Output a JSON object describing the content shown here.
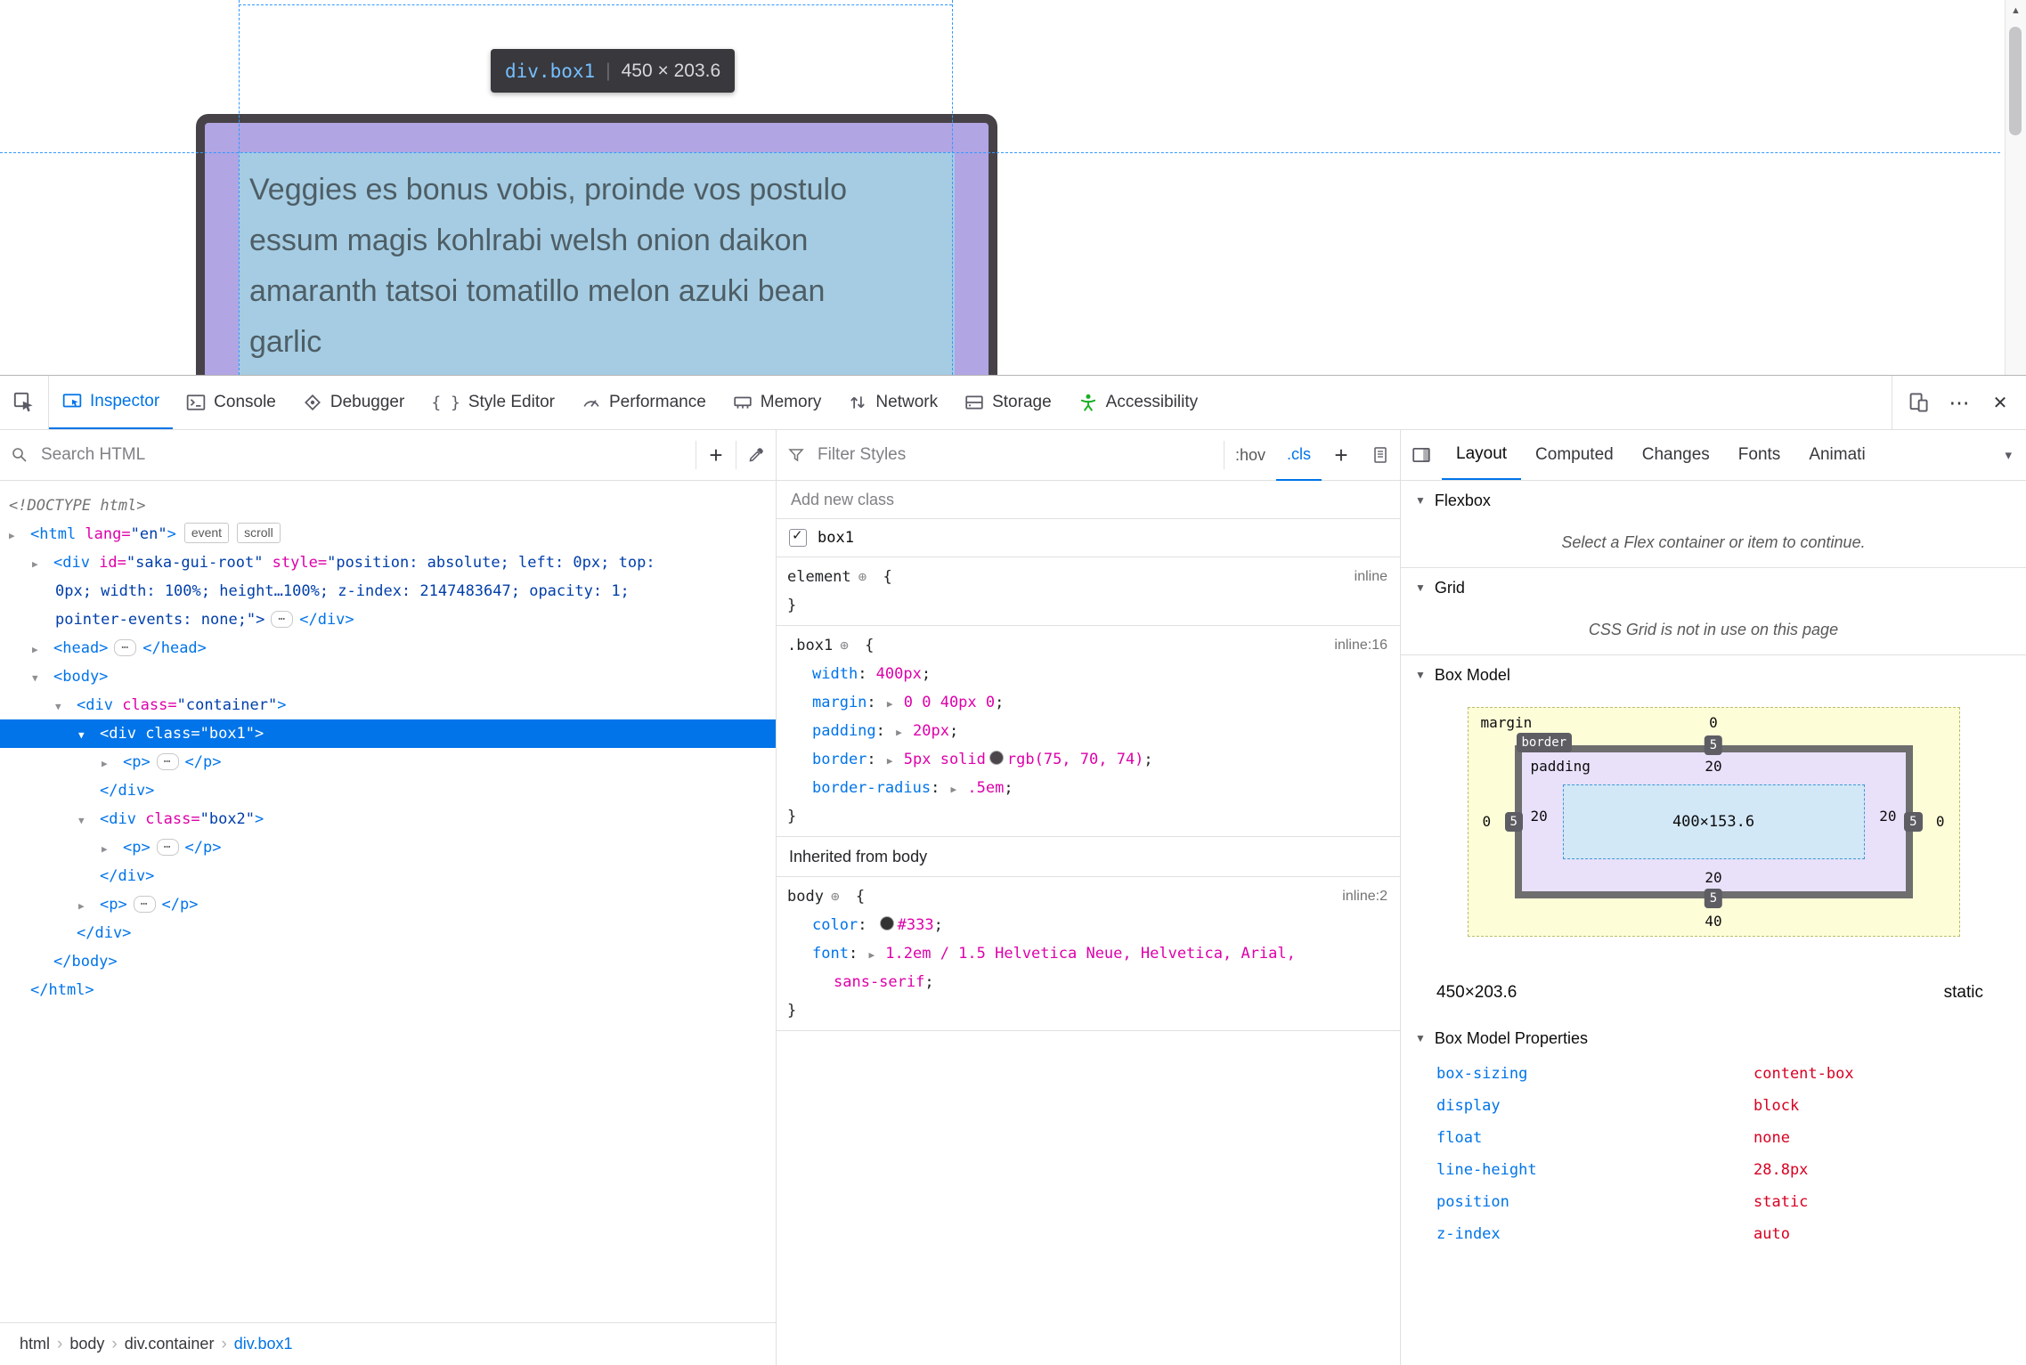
{
  "page": {
    "tooltip": {
      "selector": "div.box1",
      "dims": "450 × 203.6"
    },
    "content_lines": [
      "Veggies es bonus vobis, proinde vos postulo",
      "essum magis kohlrabi welsh onion daikon",
      "amaranth tatsoi tomatillo melon azuki bean",
      "garlic"
    ]
  },
  "glyphs": {
    "scroll_up": "▲",
    "more": "⋯",
    "close": "✕",
    "plus": "+",
    "chevron_down": "▾",
    "section_chevron": "▼",
    "breadcrumb_sep": "›",
    "brackets": "{ }"
  },
  "toolbar": {
    "tabs": [
      {
        "label": "Inspector"
      },
      {
        "label": "Console"
      },
      {
        "label": "Debugger"
      },
      {
        "label": "Style Editor"
      },
      {
        "label": "Performance"
      },
      {
        "label": "Memory"
      },
      {
        "label": "Network"
      },
      {
        "label": "Storage"
      },
      {
        "label": "Accessibility"
      }
    ]
  },
  "markup_panel": {
    "search_placeholder": "Search HTML",
    "lines": [
      {
        "ind": 10,
        "name": "doctype-line",
        "tk": [
          {
            "c": "doct",
            "t": "<!DOCTYPE html>"
          }
        ]
      },
      {
        "ind": 10,
        "name": "html-node",
        "tk": [
          {
            "c": "ar",
            "t": "▶"
          },
          {
            "c": "tag",
            "t": "<html"
          },
          {
            "c": "attr",
            "t": " lang="
          },
          {
            "c": "val",
            "t": "\"en\""
          },
          {
            "c": "tag",
            "t": ">"
          },
          {
            "c": "badge",
            "t": "event"
          },
          {
            "c": "badge",
            "t": "scroll"
          }
        ]
      },
      {
        "ind": 36,
        "name": "saka-gui-root-node",
        "tk": [
          {
            "c": "ar",
            "t": "▶"
          },
          {
            "c": "tag",
            "t": "<div"
          },
          {
            "c": "attr",
            "t": " id="
          },
          {
            "c": "val",
            "t": "\"saka-gui-root\""
          },
          {
            "c": "attr",
            "t": " style="
          },
          {
            "c": "val",
            "t": "\"position: absolute; left: 0px; top:"
          }
        ]
      },
      {
        "ind": 62,
        "name": "saka-gui-root-node",
        "tk": [
          {
            "c": "val",
            "t": "0px; width: 100%; height…100%; z-index: 2147483647; opacity: 1;"
          }
        ]
      },
      {
        "ind": 62,
        "name": "saka-gui-root-node",
        "tk": [
          {
            "c": "val",
            "t": "pointer-events: none;\">"
          },
          {
            "c": "ellipsis",
            "t": "⋯"
          },
          {
            "c": "tag",
            "t": "</div>"
          }
        ]
      },
      {
        "ind": 36,
        "name": "head-node",
        "tk": [
          {
            "c": "ar",
            "t": "▶"
          },
          {
            "c": "tag",
            "t": "<head>"
          },
          {
            "c": "ellipsis",
            "t": "⋯"
          },
          {
            "c": "tag",
            "t": "</head>"
          }
        ]
      },
      {
        "ind": 36,
        "name": "body-node",
        "tk": [
          {
            "c": "ar",
            "t": "▼"
          },
          {
            "c": "tag",
            "t": "<body>"
          }
        ]
      },
      {
        "ind": 62,
        "name": "container-node",
        "tk": [
          {
            "c": "ar",
            "t": "▼"
          },
          {
            "c": "tag",
            "t": "<div"
          },
          {
            "c": "attr",
            "t": " class="
          },
          {
            "c": "val",
            "t": "\"container\""
          },
          {
            "c": "tag",
            "t": ">"
          }
        ]
      },
      {
        "ind": 88,
        "sel": true,
        "name": "box1-node-selected",
        "tk": [
          {
            "c": "ar",
            "t": "▼"
          },
          {
            "c": "tag",
            "t": "<div"
          },
          {
            "c": "attr",
            "t": " class="
          },
          {
            "c": "val",
            "t": "\"box1\""
          },
          {
            "c": "tag",
            "t": ">"
          }
        ]
      },
      {
        "ind": 114,
        "name": "p-node",
        "tk": [
          {
            "c": "ar",
            "t": "▶"
          },
          {
            "c": "tag",
            "t": "<p>"
          },
          {
            "c": "ellipsis",
            "t": "⋯"
          },
          {
            "c": "tag",
            "t": "</p>"
          }
        ]
      },
      {
        "ind": 112,
        "name": "closing-tag",
        "tk": [
          {
            "c": "tag",
            "t": "</div>"
          }
        ]
      },
      {
        "ind": 88,
        "name": "box2-node",
        "tk": [
          {
            "c": "ar",
            "t": "▼"
          },
          {
            "c": "tag",
            "t": "<div"
          },
          {
            "c": "attr",
            "t": " class="
          },
          {
            "c": "val",
            "t": "\"box2\""
          },
          {
            "c": "tag",
            "t": ">"
          }
        ]
      },
      {
        "ind": 114,
        "name": "p-node",
        "tk": [
          {
            "c": "ar",
            "t": "▶"
          },
          {
            "c": "tag",
            "t": "<p>"
          },
          {
            "c": "ellipsis",
            "t": "⋯"
          },
          {
            "c": "tag",
            "t": "</p>"
          }
        ]
      },
      {
        "ind": 112,
        "name": "closing-tag",
        "tk": [
          {
            "c": "tag",
            "t": "</div>"
          }
        ]
      },
      {
        "ind": 88,
        "name": "p-node",
        "tk": [
          {
            "c": "ar",
            "t": "▶"
          },
          {
            "c": "tag",
            "t": "<p>"
          },
          {
            "c": "ellipsis",
            "t": "⋯"
          },
          {
            "c": "tag",
            "t": "</p>"
          }
        ]
      },
      {
        "ind": 86,
        "name": "closing-tag",
        "tk": [
          {
            "c": "tag",
            "t": "</div>"
          }
        ]
      },
      {
        "ind": 60,
        "name": "closing-tag",
        "tk": [
          {
            "c": "tag",
            "t": "</body>"
          }
        ]
      },
      {
        "ind": 34,
        "name": "closing-tag",
        "tk": [
          {
            "c": "tag",
            "t": "</html>"
          }
        ]
      }
    ],
    "breadcrumbs": [
      {
        "label": "html"
      },
      {
        "label": "body"
      },
      {
        "label": "div.container"
      },
      {
        "label": "div.box1"
      }
    ]
  },
  "rules_panel": {
    "filter_placeholder": "Filter Styles",
    "pseudo_button": ":hov",
    "class_button": ".cls",
    "add_class_placeholder": "Add new class",
    "class_toggle_label": "box1",
    "inherited_header": "Inherited from body",
    "rule_element": {
      "lines": [
        {
          "ind": 12,
          "right": "inline",
          "name": "rule-selector",
          "tk": [
            {
              "c": "sel",
              "t": "element"
            },
            {
              "c": "target",
              "t": "⊕",
              "n": "selector-highlight-icon"
            },
            {
              "c": "b",
              "t": " {"
            }
          ]
        },
        {
          "ind": 12,
          "name": "rule-close",
          "tk": [
            {
              "c": "b",
              "t": "}"
            }
          ]
        }
      ]
    },
    "rule_box1": {
      "lines": [
        {
          "ind": 12,
          "right": "inline:16",
          "name": "rule-selector",
          "tk": [
            {
              "c": "sel",
              "t": ".box1"
            },
            {
              "c": "target",
              "t": "⊕",
              "n": "selector-highlight-icon"
            },
            {
              "c": "b",
              "t": " {"
            }
          ]
        },
        {
          "ind": 40,
          "name": "css-declaration",
          "tk": [
            {
              "c": "prop",
              "t": "width"
            },
            {
              "c": "b",
              "t": ": "
            },
            {
              "c": "value",
              "t": "400px"
            },
            {
              "c": "b",
              "t": ";"
            }
          ]
        },
        {
          "ind": 40,
          "name": "css-declaration",
          "tk": [
            {
              "c": "prop",
              "t": "margin"
            },
            {
              "c": "b",
              "t": ": "
            },
            {
              "c": "tri",
              "t": "▶"
            },
            {
              "c": "value",
              "t": " 0 0 40px 0"
            },
            {
              "c": "b",
              "t": ";"
            }
          ]
        },
        {
          "ind": 40,
          "name": "css-declaration",
          "tk": [
            {
              "c": "prop",
              "t": "padding"
            },
            {
              "c": "b",
              "t": ": "
            },
            {
              "c": "tri",
              "t": "▶"
            },
            {
              "c": "value",
              "t": " 20px"
            },
            {
              "c": "b",
              "t": ";"
            }
          ]
        },
        {
          "ind": 40,
          "name": "css-declaration",
          "tk": [
            {
              "c": "prop",
              "t": "border"
            },
            {
              "c": "b",
              "t": ": "
            },
            {
              "c": "tri",
              "t": "▶"
            },
            {
              "c": "value",
              "t": " 5px solid"
            },
            {
              "c": "swatch",
              "t": "#4b464a",
              "n": "color-swatch"
            },
            {
              "c": "value",
              "t": "rgb(75, 70, 74)"
            },
            {
              "c": "b",
              "t": ";"
            }
          ]
        },
        {
          "ind": 40,
          "name": "css-declaration",
          "tk": [
            {
              "c": "prop",
              "t": "border-radius"
            },
            {
              "c": "b",
              "t": ": "
            },
            {
              "c": "tri",
              "t": "▶"
            },
            {
              "c": "value",
              "t": " .5em"
            },
            {
              "c": "b",
              "t": ";"
            }
          ]
        },
        {
          "ind": 12,
          "name": "rule-close",
          "tk": [
            {
              "c": "b",
              "t": "}"
            }
          ]
        }
      ]
    },
    "rule_body": {
      "lines": [
        {
          "ind": 12,
          "right": "inline:2",
          "name": "rule-selector",
          "tk": [
            {
              "c": "sel",
              "t": "body"
            },
            {
              "c": "target",
              "t": "⊕",
              "n": "selector-highlight-icon"
            },
            {
              "c": "b",
              "t": " {"
            }
          ]
        },
        {
          "ind": 40,
          "name": "css-declaration",
          "tk": [
            {
              "c": "prop",
              "t": "color"
            },
            {
              "c": "b",
              "t": ": "
            },
            {
              "c": "swatch",
              "t": "#333333",
              "n": "color-swatch"
            },
            {
              "c": "value",
              "t": "#333"
            },
            {
              "c": "b",
              "t": ";"
            }
          ]
        },
        {
          "ind": 40,
          "name": "css-declaration",
          "tk": [
            {
              "c": "prop",
              "t": "font"
            },
            {
              "c": "b",
              "t": ": "
            },
            {
              "c": "tri",
              "t": "▶"
            },
            {
              "c": "value",
              "t": " 1.2em / 1.5 Helvetica Neue, Helvetica, Arial,"
            }
          ]
        },
        {
          "ind": 64,
          "name": "css-declaration",
          "tk": [
            {
              "c": "value",
              "t": "sans-serif"
            },
            {
              "c": "b",
              "t": ";"
            }
          ]
        },
        {
          "ind": 12,
          "name": "rule-close",
          "tk": [
            {
              "c": "b",
              "t": "}"
            }
          ]
        }
      ]
    }
  },
  "layout_panel": {
    "tabs": [
      {
        "label": "Layout"
      },
      {
        "label": "Computed"
      },
      {
        "label": "Changes"
      },
      {
        "label": "Fonts"
      },
      {
        "label": "Animati"
      }
    ],
    "flexbox": {
      "title": "Flexbox",
      "message": "Select a Flex container or item to continue."
    },
    "grid": {
      "title": "Grid",
      "message": "CSS Grid is not in use on this page"
    },
    "box_model": {
      "title": "Box Model",
      "margin": {
        "label": "margin",
        "top": "0",
        "right": "0",
        "bottom": "40",
        "left": "0"
      },
      "border": {
        "label": "border",
        "top": "5",
        "right": "5",
        "bottom": "5",
        "left": "5"
      },
      "padding": {
        "label": "padding",
        "top": "20",
        "right": "20",
        "bottom": "20",
        "left": "20"
      },
      "content": "400×153.6",
      "total": "450×203.6",
      "position": "static"
    },
    "properties": {
      "title": "Box Model Properties",
      "rows": [
        {
          "name": "box-sizing",
          "value": "content-box"
        },
        {
          "name": "display",
          "value": "block"
        },
        {
          "name": "float",
          "value": "none"
        },
        {
          "name": "line-height",
          "value": "28.8px"
        },
        {
          "name": "position",
          "value": "static"
        },
        {
          "name": "z-index",
          "value": "auto"
        }
      ]
    }
  }
}
